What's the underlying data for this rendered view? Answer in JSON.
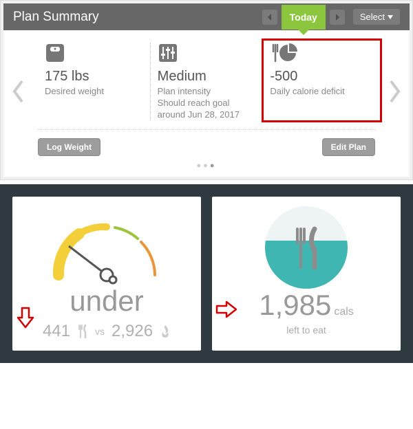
{
  "header": {
    "title": "Plan Summary",
    "today_label": "Today",
    "select_label": "Select"
  },
  "summary": {
    "weight": {
      "value": "175 lbs",
      "label": "Desired weight"
    },
    "intensity": {
      "value": "Medium",
      "label": "Plan intensity",
      "note": "Should reach goal around Jun 28, 2017"
    },
    "deficit": {
      "value": "-500",
      "label": "Daily calorie deficit"
    }
  },
  "buttons": {
    "log_weight": "Log Weight",
    "edit_plan": "Edit Plan"
  },
  "gauge": {
    "status": "under",
    "consumed": "441",
    "vs": "vs",
    "burned": "2,926"
  },
  "calories": {
    "remaining": "1,985",
    "unit": "cals",
    "label": "left to eat"
  }
}
